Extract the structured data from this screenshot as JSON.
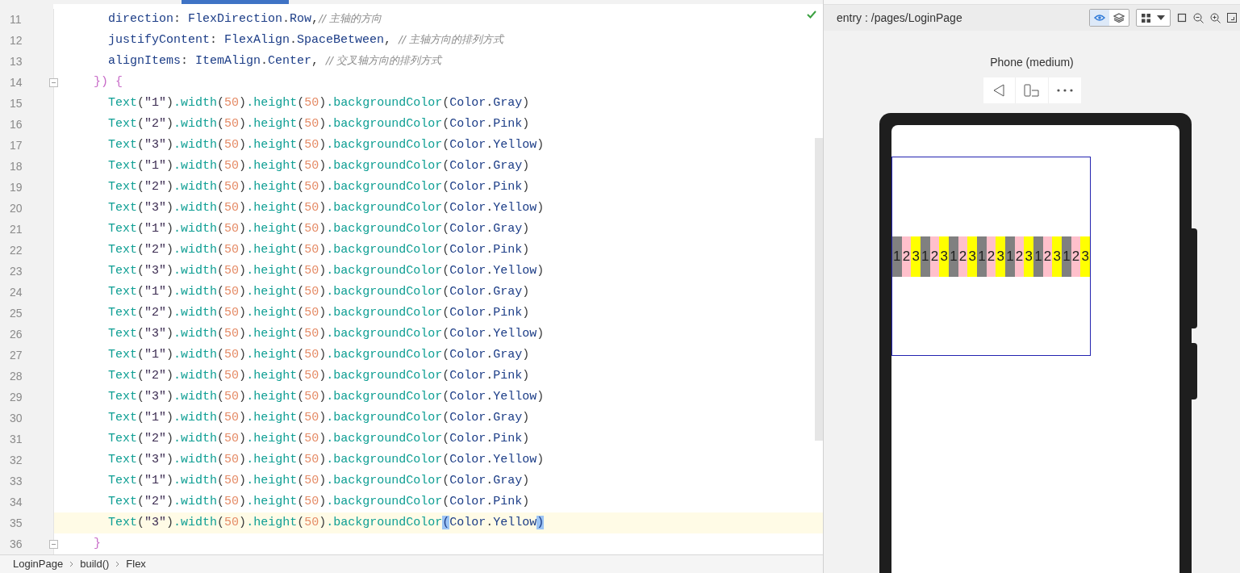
{
  "editor": {
    "lines": [
      {
        "number": "11",
        "current": false,
        "foldable": false,
        "tokens": [
          {
            "text": "      direction",
            "kind": "i"
          },
          {
            "text": ": ",
            "kind": "p"
          },
          {
            "text": "FlexDirection",
            "kind": "i"
          },
          {
            "text": ".",
            "kind": "p"
          },
          {
            "text": "Row",
            "kind": "i"
          },
          {
            "text": ",",
            "kind": "p"
          },
          {
            "text": "// 主轴的方向",
            "kind": "c"
          }
        ]
      },
      {
        "number": "12",
        "current": false,
        "foldable": false,
        "tokens": [
          {
            "text": "      justifyContent",
            "kind": "i"
          },
          {
            "text": ": ",
            "kind": "p"
          },
          {
            "text": "FlexAlign",
            "kind": "i"
          },
          {
            "text": ".",
            "kind": "p"
          },
          {
            "text": "SpaceBetween",
            "kind": "i"
          },
          {
            "text": ", ",
            "kind": "p"
          },
          {
            "text": "// 主轴方向的排列方式",
            "kind": "c"
          }
        ]
      },
      {
        "number": "13",
        "current": false,
        "foldable": false,
        "tokens": [
          {
            "text": "      alignItems",
            "kind": "i"
          },
          {
            "text": ": ",
            "kind": "p"
          },
          {
            "text": "ItemAlign",
            "kind": "i"
          },
          {
            "text": ".",
            "kind": "p"
          },
          {
            "text": "Center",
            "kind": "i"
          },
          {
            "text": ", ",
            "kind": "p"
          },
          {
            "text": "// 交叉轴方向的排列方式",
            "kind": "c"
          }
        ]
      },
      {
        "number": "14",
        "current": false,
        "foldable": true,
        "tokens": [
          {
            "text": "    }) {",
            "kind": "b"
          }
        ]
      },
      {
        "number": "15",
        "current": false,
        "foldable": false,
        "tokens": [
          {
            "text": "      Text",
            "kind": "f"
          },
          {
            "text": "(",
            "kind": "p"
          },
          {
            "text": "\"1\"",
            "kind": "s"
          },
          {
            "text": ")",
            "kind": "p"
          },
          {
            "text": ".width",
            "kind": "f"
          },
          {
            "text": "(",
            "kind": "p"
          },
          {
            "text": "50",
            "kind": "n"
          },
          {
            "text": ")",
            "kind": "p"
          },
          {
            "text": ".height",
            "kind": "f"
          },
          {
            "text": "(",
            "kind": "p"
          },
          {
            "text": "50",
            "kind": "n"
          },
          {
            "text": ")",
            "kind": "p"
          },
          {
            "text": ".backgroundColor",
            "kind": "f"
          },
          {
            "text": "(",
            "kind": "p"
          },
          {
            "text": "Color",
            "kind": "i"
          },
          {
            "text": ".",
            "kind": "p"
          },
          {
            "text": "Gray",
            "kind": "i"
          },
          {
            "text": ")",
            "kind": "p"
          }
        ]
      },
      {
        "number": "16",
        "current": false,
        "foldable": false,
        "tokens": [
          {
            "text": "      Text",
            "kind": "f"
          },
          {
            "text": "(",
            "kind": "p"
          },
          {
            "text": "\"2\"",
            "kind": "s"
          },
          {
            "text": ")",
            "kind": "p"
          },
          {
            "text": ".width",
            "kind": "f"
          },
          {
            "text": "(",
            "kind": "p"
          },
          {
            "text": "50",
            "kind": "n"
          },
          {
            "text": ")",
            "kind": "p"
          },
          {
            "text": ".height",
            "kind": "f"
          },
          {
            "text": "(",
            "kind": "p"
          },
          {
            "text": "50",
            "kind": "n"
          },
          {
            "text": ")",
            "kind": "p"
          },
          {
            "text": ".backgroundColor",
            "kind": "f"
          },
          {
            "text": "(",
            "kind": "p"
          },
          {
            "text": "Color",
            "kind": "i"
          },
          {
            "text": ".",
            "kind": "p"
          },
          {
            "text": "Pink",
            "kind": "i"
          },
          {
            "text": ")",
            "kind": "p"
          }
        ]
      },
      {
        "number": "17",
        "current": false,
        "foldable": false,
        "tokens": [
          {
            "text": "      Text",
            "kind": "f"
          },
          {
            "text": "(",
            "kind": "p"
          },
          {
            "text": "\"3\"",
            "kind": "s"
          },
          {
            "text": ")",
            "kind": "p"
          },
          {
            "text": ".width",
            "kind": "f"
          },
          {
            "text": "(",
            "kind": "p"
          },
          {
            "text": "50",
            "kind": "n"
          },
          {
            "text": ")",
            "kind": "p"
          },
          {
            "text": ".height",
            "kind": "f"
          },
          {
            "text": "(",
            "kind": "p"
          },
          {
            "text": "50",
            "kind": "n"
          },
          {
            "text": ")",
            "kind": "p"
          },
          {
            "text": ".backgroundColor",
            "kind": "f"
          },
          {
            "text": "(",
            "kind": "p"
          },
          {
            "text": "Color",
            "kind": "i"
          },
          {
            "text": ".",
            "kind": "p"
          },
          {
            "text": "Yellow",
            "kind": "i"
          },
          {
            "text": ")",
            "kind": "p"
          }
        ]
      },
      {
        "number": "18",
        "current": false,
        "foldable": false,
        "tokens": [
          {
            "text": "      Text",
            "kind": "f"
          },
          {
            "text": "(",
            "kind": "p"
          },
          {
            "text": "\"1\"",
            "kind": "s"
          },
          {
            "text": ")",
            "kind": "p"
          },
          {
            "text": ".width",
            "kind": "f"
          },
          {
            "text": "(",
            "kind": "p"
          },
          {
            "text": "50",
            "kind": "n"
          },
          {
            "text": ")",
            "kind": "p"
          },
          {
            "text": ".height",
            "kind": "f"
          },
          {
            "text": "(",
            "kind": "p"
          },
          {
            "text": "50",
            "kind": "n"
          },
          {
            "text": ")",
            "kind": "p"
          },
          {
            "text": ".backgroundColor",
            "kind": "f"
          },
          {
            "text": "(",
            "kind": "p"
          },
          {
            "text": "Color",
            "kind": "i"
          },
          {
            "text": ".",
            "kind": "p"
          },
          {
            "text": "Gray",
            "kind": "i"
          },
          {
            "text": ")",
            "kind": "p"
          }
        ]
      },
      {
        "number": "19",
        "current": false,
        "foldable": false,
        "tokens": [
          {
            "text": "      Text",
            "kind": "f"
          },
          {
            "text": "(",
            "kind": "p"
          },
          {
            "text": "\"2\"",
            "kind": "s"
          },
          {
            "text": ")",
            "kind": "p"
          },
          {
            "text": ".width",
            "kind": "f"
          },
          {
            "text": "(",
            "kind": "p"
          },
          {
            "text": "50",
            "kind": "n"
          },
          {
            "text": ")",
            "kind": "p"
          },
          {
            "text": ".height",
            "kind": "f"
          },
          {
            "text": "(",
            "kind": "p"
          },
          {
            "text": "50",
            "kind": "n"
          },
          {
            "text": ")",
            "kind": "p"
          },
          {
            "text": ".backgroundColor",
            "kind": "f"
          },
          {
            "text": "(",
            "kind": "p"
          },
          {
            "text": "Color",
            "kind": "i"
          },
          {
            "text": ".",
            "kind": "p"
          },
          {
            "text": "Pink",
            "kind": "i"
          },
          {
            "text": ")",
            "kind": "p"
          }
        ]
      },
      {
        "number": "20",
        "current": false,
        "foldable": false,
        "tokens": [
          {
            "text": "      Text",
            "kind": "f"
          },
          {
            "text": "(",
            "kind": "p"
          },
          {
            "text": "\"3\"",
            "kind": "s"
          },
          {
            "text": ")",
            "kind": "p"
          },
          {
            "text": ".width",
            "kind": "f"
          },
          {
            "text": "(",
            "kind": "p"
          },
          {
            "text": "50",
            "kind": "n"
          },
          {
            "text": ")",
            "kind": "p"
          },
          {
            "text": ".height",
            "kind": "f"
          },
          {
            "text": "(",
            "kind": "p"
          },
          {
            "text": "50",
            "kind": "n"
          },
          {
            "text": ")",
            "kind": "p"
          },
          {
            "text": ".backgroundColor",
            "kind": "f"
          },
          {
            "text": "(",
            "kind": "p"
          },
          {
            "text": "Color",
            "kind": "i"
          },
          {
            "text": ".",
            "kind": "p"
          },
          {
            "text": "Yellow",
            "kind": "i"
          },
          {
            "text": ")",
            "kind": "p"
          }
        ]
      },
      {
        "number": "21",
        "current": false,
        "foldable": false,
        "tokens": [
          {
            "text": "      Text",
            "kind": "f"
          },
          {
            "text": "(",
            "kind": "p"
          },
          {
            "text": "\"1\"",
            "kind": "s"
          },
          {
            "text": ")",
            "kind": "p"
          },
          {
            "text": ".width",
            "kind": "f"
          },
          {
            "text": "(",
            "kind": "p"
          },
          {
            "text": "50",
            "kind": "n"
          },
          {
            "text": ")",
            "kind": "p"
          },
          {
            "text": ".height",
            "kind": "f"
          },
          {
            "text": "(",
            "kind": "p"
          },
          {
            "text": "50",
            "kind": "n"
          },
          {
            "text": ")",
            "kind": "p"
          },
          {
            "text": ".backgroundColor",
            "kind": "f"
          },
          {
            "text": "(",
            "kind": "p"
          },
          {
            "text": "Color",
            "kind": "i"
          },
          {
            "text": ".",
            "kind": "p"
          },
          {
            "text": "Gray",
            "kind": "i"
          },
          {
            "text": ")",
            "kind": "p"
          }
        ]
      },
      {
        "number": "22",
        "current": false,
        "foldable": false,
        "tokens": [
          {
            "text": "      Text",
            "kind": "f"
          },
          {
            "text": "(",
            "kind": "p"
          },
          {
            "text": "\"2\"",
            "kind": "s"
          },
          {
            "text": ")",
            "kind": "p"
          },
          {
            "text": ".width",
            "kind": "f"
          },
          {
            "text": "(",
            "kind": "p"
          },
          {
            "text": "50",
            "kind": "n"
          },
          {
            "text": ")",
            "kind": "p"
          },
          {
            "text": ".height",
            "kind": "f"
          },
          {
            "text": "(",
            "kind": "p"
          },
          {
            "text": "50",
            "kind": "n"
          },
          {
            "text": ")",
            "kind": "p"
          },
          {
            "text": ".backgroundColor",
            "kind": "f"
          },
          {
            "text": "(",
            "kind": "p"
          },
          {
            "text": "Color",
            "kind": "i"
          },
          {
            "text": ".",
            "kind": "p"
          },
          {
            "text": "Pink",
            "kind": "i"
          },
          {
            "text": ")",
            "kind": "p"
          }
        ]
      },
      {
        "number": "23",
        "current": false,
        "foldable": false,
        "tokens": [
          {
            "text": "      Text",
            "kind": "f"
          },
          {
            "text": "(",
            "kind": "p"
          },
          {
            "text": "\"3\"",
            "kind": "s"
          },
          {
            "text": ")",
            "kind": "p"
          },
          {
            "text": ".width",
            "kind": "f"
          },
          {
            "text": "(",
            "kind": "p"
          },
          {
            "text": "50",
            "kind": "n"
          },
          {
            "text": ")",
            "kind": "p"
          },
          {
            "text": ".height",
            "kind": "f"
          },
          {
            "text": "(",
            "kind": "p"
          },
          {
            "text": "50",
            "kind": "n"
          },
          {
            "text": ")",
            "kind": "p"
          },
          {
            "text": ".backgroundColor",
            "kind": "f"
          },
          {
            "text": "(",
            "kind": "p"
          },
          {
            "text": "Color",
            "kind": "i"
          },
          {
            "text": ".",
            "kind": "p"
          },
          {
            "text": "Yellow",
            "kind": "i"
          },
          {
            "text": ")",
            "kind": "p"
          }
        ]
      },
      {
        "number": "24",
        "current": false,
        "foldable": false,
        "tokens": [
          {
            "text": "      Text",
            "kind": "f"
          },
          {
            "text": "(",
            "kind": "p"
          },
          {
            "text": "\"1\"",
            "kind": "s"
          },
          {
            "text": ")",
            "kind": "p"
          },
          {
            "text": ".width",
            "kind": "f"
          },
          {
            "text": "(",
            "kind": "p"
          },
          {
            "text": "50",
            "kind": "n"
          },
          {
            "text": ")",
            "kind": "p"
          },
          {
            "text": ".height",
            "kind": "f"
          },
          {
            "text": "(",
            "kind": "p"
          },
          {
            "text": "50",
            "kind": "n"
          },
          {
            "text": ")",
            "kind": "p"
          },
          {
            "text": ".backgroundColor",
            "kind": "f"
          },
          {
            "text": "(",
            "kind": "p"
          },
          {
            "text": "Color",
            "kind": "i"
          },
          {
            "text": ".",
            "kind": "p"
          },
          {
            "text": "Gray",
            "kind": "i"
          },
          {
            "text": ")",
            "kind": "p"
          }
        ]
      },
      {
        "number": "25",
        "current": false,
        "foldable": false,
        "tokens": [
          {
            "text": "      Text",
            "kind": "f"
          },
          {
            "text": "(",
            "kind": "p"
          },
          {
            "text": "\"2\"",
            "kind": "s"
          },
          {
            "text": ")",
            "kind": "p"
          },
          {
            "text": ".width",
            "kind": "f"
          },
          {
            "text": "(",
            "kind": "p"
          },
          {
            "text": "50",
            "kind": "n"
          },
          {
            "text": ")",
            "kind": "p"
          },
          {
            "text": ".height",
            "kind": "f"
          },
          {
            "text": "(",
            "kind": "p"
          },
          {
            "text": "50",
            "kind": "n"
          },
          {
            "text": ")",
            "kind": "p"
          },
          {
            "text": ".backgroundColor",
            "kind": "f"
          },
          {
            "text": "(",
            "kind": "p"
          },
          {
            "text": "Color",
            "kind": "i"
          },
          {
            "text": ".",
            "kind": "p"
          },
          {
            "text": "Pink",
            "kind": "i"
          },
          {
            "text": ")",
            "kind": "p"
          }
        ]
      },
      {
        "number": "26",
        "current": false,
        "foldable": false,
        "tokens": [
          {
            "text": "      Text",
            "kind": "f"
          },
          {
            "text": "(",
            "kind": "p"
          },
          {
            "text": "\"3\"",
            "kind": "s"
          },
          {
            "text": ")",
            "kind": "p"
          },
          {
            "text": ".width",
            "kind": "f"
          },
          {
            "text": "(",
            "kind": "p"
          },
          {
            "text": "50",
            "kind": "n"
          },
          {
            "text": ")",
            "kind": "p"
          },
          {
            "text": ".height",
            "kind": "f"
          },
          {
            "text": "(",
            "kind": "p"
          },
          {
            "text": "50",
            "kind": "n"
          },
          {
            "text": ")",
            "kind": "p"
          },
          {
            "text": ".backgroundColor",
            "kind": "f"
          },
          {
            "text": "(",
            "kind": "p"
          },
          {
            "text": "Color",
            "kind": "i"
          },
          {
            "text": ".",
            "kind": "p"
          },
          {
            "text": "Yellow",
            "kind": "i"
          },
          {
            "text": ")",
            "kind": "p"
          }
        ]
      },
      {
        "number": "27",
        "current": false,
        "foldable": false,
        "tokens": [
          {
            "text": "      Text",
            "kind": "f"
          },
          {
            "text": "(",
            "kind": "p"
          },
          {
            "text": "\"1\"",
            "kind": "s"
          },
          {
            "text": ")",
            "kind": "p"
          },
          {
            "text": ".width",
            "kind": "f"
          },
          {
            "text": "(",
            "kind": "p"
          },
          {
            "text": "50",
            "kind": "n"
          },
          {
            "text": ")",
            "kind": "p"
          },
          {
            "text": ".height",
            "kind": "f"
          },
          {
            "text": "(",
            "kind": "p"
          },
          {
            "text": "50",
            "kind": "n"
          },
          {
            "text": ")",
            "kind": "p"
          },
          {
            "text": ".backgroundColor",
            "kind": "f"
          },
          {
            "text": "(",
            "kind": "p"
          },
          {
            "text": "Color",
            "kind": "i"
          },
          {
            "text": ".",
            "kind": "p"
          },
          {
            "text": "Gray",
            "kind": "i"
          },
          {
            "text": ")",
            "kind": "p"
          }
        ]
      },
      {
        "number": "28",
        "current": false,
        "foldable": false,
        "tokens": [
          {
            "text": "      Text",
            "kind": "f"
          },
          {
            "text": "(",
            "kind": "p"
          },
          {
            "text": "\"2\"",
            "kind": "s"
          },
          {
            "text": ")",
            "kind": "p"
          },
          {
            "text": ".width",
            "kind": "f"
          },
          {
            "text": "(",
            "kind": "p"
          },
          {
            "text": "50",
            "kind": "n"
          },
          {
            "text": ")",
            "kind": "p"
          },
          {
            "text": ".height",
            "kind": "f"
          },
          {
            "text": "(",
            "kind": "p"
          },
          {
            "text": "50",
            "kind": "n"
          },
          {
            "text": ")",
            "kind": "p"
          },
          {
            "text": ".backgroundColor",
            "kind": "f"
          },
          {
            "text": "(",
            "kind": "p"
          },
          {
            "text": "Color",
            "kind": "i"
          },
          {
            "text": ".",
            "kind": "p"
          },
          {
            "text": "Pink",
            "kind": "i"
          },
          {
            "text": ")",
            "kind": "p"
          }
        ]
      },
      {
        "number": "29",
        "current": false,
        "foldable": false,
        "tokens": [
          {
            "text": "      Text",
            "kind": "f"
          },
          {
            "text": "(",
            "kind": "p"
          },
          {
            "text": "\"3\"",
            "kind": "s"
          },
          {
            "text": ")",
            "kind": "p"
          },
          {
            "text": ".width",
            "kind": "f"
          },
          {
            "text": "(",
            "kind": "p"
          },
          {
            "text": "50",
            "kind": "n"
          },
          {
            "text": ")",
            "kind": "p"
          },
          {
            "text": ".height",
            "kind": "f"
          },
          {
            "text": "(",
            "kind": "p"
          },
          {
            "text": "50",
            "kind": "n"
          },
          {
            "text": ")",
            "kind": "p"
          },
          {
            "text": ".backgroundColor",
            "kind": "f"
          },
          {
            "text": "(",
            "kind": "p"
          },
          {
            "text": "Color",
            "kind": "i"
          },
          {
            "text": ".",
            "kind": "p"
          },
          {
            "text": "Yellow",
            "kind": "i"
          },
          {
            "text": ")",
            "kind": "p"
          }
        ]
      },
      {
        "number": "30",
        "current": false,
        "foldable": false,
        "tokens": [
          {
            "text": "      Text",
            "kind": "f"
          },
          {
            "text": "(",
            "kind": "p"
          },
          {
            "text": "\"1\"",
            "kind": "s"
          },
          {
            "text": ")",
            "kind": "p"
          },
          {
            "text": ".width",
            "kind": "f"
          },
          {
            "text": "(",
            "kind": "p"
          },
          {
            "text": "50",
            "kind": "n"
          },
          {
            "text": ")",
            "kind": "p"
          },
          {
            "text": ".height",
            "kind": "f"
          },
          {
            "text": "(",
            "kind": "p"
          },
          {
            "text": "50",
            "kind": "n"
          },
          {
            "text": ")",
            "kind": "p"
          },
          {
            "text": ".backgroundColor",
            "kind": "f"
          },
          {
            "text": "(",
            "kind": "p"
          },
          {
            "text": "Color",
            "kind": "i"
          },
          {
            "text": ".",
            "kind": "p"
          },
          {
            "text": "Gray",
            "kind": "i"
          },
          {
            "text": ")",
            "kind": "p"
          }
        ]
      },
      {
        "number": "31",
        "current": false,
        "foldable": false,
        "tokens": [
          {
            "text": "      Text",
            "kind": "f"
          },
          {
            "text": "(",
            "kind": "p"
          },
          {
            "text": "\"2\"",
            "kind": "s"
          },
          {
            "text": ")",
            "kind": "p"
          },
          {
            "text": ".width",
            "kind": "f"
          },
          {
            "text": "(",
            "kind": "p"
          },
          {
            "text": "50",
            "kind": "n"
          },
          {
            "text": ")",
            "kind": "p"
          },
          {
            "text": ".height",
            "kind": "f"
          },
          {
            "text": "(",
            "kind": "p"
          },
          {
            "text": "50",
            "kind": "n"
          },
          {
            "text": ")",
            "kind": "p"
          },
          {
            "text": ".backgroundColor",
            "kind": "f"
          },
          {
            "text": "(",
            "kind": "p"
          },
          {
            "text": "Color",
            "kind": "i"
          },
          {
            "text": ".",
            "kind": "p"
          },
          {
            "text": "Pink",
            "kind": "i"
          },
          {
            "text": ")",
            "kind": "p"
          }
        ]
      },
      {
        "number": "32",
        "current": false,
        "foldable": false,
        "tokens": [
          {
            "text": "      Text",
            "kind": "f"
          },
          {
            "text": "(",
            "kind": "p"
          },
          {
            "text": "\"3\"",
            "kind": "s"
          },
          {
            "text": ")",
            "kind": "p"
          },
          {
            "text": ".width",
            "kind": "f"
          },
          {
            "text": "(",
            "kind": "p"
          },
          {
            "text": "50",
            "kind": "n"
          },
          {
            "text": ")",
            "kind": "p"
          },
          {
            "text": ".height",
            "kind": "f"
          },
          {
            "text": "(",
            "kind": "p"
          },
          {
            "text": "50",
            "kind": "n"
          },
          {
            "text": ")",
            "kind": "p"
          },
          {
            "text": ".backgroundColor",
            "kind": "f"
          },
          {
            "text": "(",
            "kind": "p"
          },
          {
            "text": "Color",
            "kind": "i"
          },
          {
            "text": ".",
            "kind": "p"
          },
          {
            "text": "Yellow",
            "kind": "i"
          },
          {
            "text": ")",
            "kind": "p"
          }
        ]
      },
      {
        "number": "33",
        "current": false,
        "foldable": false,
        "tokens": [
          {
            "text": "      Text",
            "kind": "f"
          },
          {
            "text": "(",
            "kind": "p"
          },
          {
            "text": "\"1\"",
            "kind": "s"
          },
          {
            "text": ")",
            "kind": "p"
          },
          {
            "text": ".width",
            "kind": "f"
          },
          {
            "text": "(",
            "kind": "p"
          },
          {
            "text": "50",
            "kind": "n"
          },
          {
            "text": ")",
            "kind": "p"
          },
          {
            "text": ".height",
            "kind": "f"
          },
          {
            "text": "(",
            "kind": "p"
          },
          {
            "text": "50",
            "kind": "n"
          },
          {
            "text": ")",
            "kind": "p"
          },
          {
            "text": ".backgroundColor",
            "kind": "f"
          },
          {
            "text": "(",
            "kind": "p"
          },
          {
            "text": "Color",
            "kind": "i"
          },
          {
            "text": ".",
            "kind": "p"
          },
          {
            "text": "Gray",
            "kind": "i"
          },
          {
            "text": ")",
            "kind": "p"
          }
        ]
      },
      {
        "number": "34",
        "current": false,
        "foldable": false,
        "tokens": [
          {
            "text": "      Text",
            "kind": "f"
          },
          {
            "text": "(",
            "kind": "p"
          },
          {
            "text": "\"2\"",
            "kind": "s"
          },
          {
            "text": ")",
            "kind": "p"
          },
          {
            "text": ".width",
            "kind": "f"
          },
          {
            "text": "(",
            "kind": "p"
          },
          {
            "text": "50",
            "kind": "n"
          },
          {
            "text": ")",
            "kind": "p"
          },
          {
            "text": ".height",
            "kind": "f"
          },
          {
            "text": "(",
            "kind": "p"
          },
          {
            "text": "50",
            "kind": "n"
          },
          {
            "text": ")",
            "kind": "p"
          },
          {
            "text": ".backgroundColor",
            "kind": "f"
          },
          {
            "text": "(",
            "kind": "p"
          },
          {
            "text": "Color",
            "kind": "i"
          },
          {
            "text": ".",
            "kind": "p"
          },
          {
            "text": "Pink",
            "kind": "i"
          },
          {
            "text": ")",
            "kind": "p"
          }
        ]
      },
      {
        "number": "35",
        "current": true,
        "foldable": false,
        "tokens": [
          {
            "text": "      Text",
            "kind": "f"
          },
          {
            "text": "(",
            "kind": "p"
          },
          {
            "text": "\"3\"",
            "kind": "s"
          },
          {
            "text": ")",
            "kind": "p"
          },
          {
            "text": ".width",
            "kind": "f"
          },
          {
            "text": "(",
            "kind": "p"
          },
          {
            "text": "50",
            "kind": "n"
          },
          {
            "text": ")",
            "kind": "p"
          },
          {
            "text": ".height",
            "kind": "f"
          },
          {
            "text": "(",
            "kind": "p"
          },
          {
            "text": "50",
            "kind": "n"
          },
          {
            "text": ")",
            "kind": "p"
          },
          {
            "text": ".backgroundColor",
            "kind": "f"
          },
          {
            "text": "(",
            "kind": "m"
          },
          {
            "text": "Color",
            "kind": "i"
          },
          {
            "text": ".",
            "kind": "p"
          },
          {
            "text": "Yellow",
            "kind": "i"
          },
          {
            "text": ")",
            "kind": "m"
          }
        ]
      },
      {
        "number": "36",
        "current": false,
        "foldable": true,
        "tokens": [
          {
            "text": "    }",
            "kind": "b"
          }
        ]
      }
    ]
  },
  "breadcrumb": [
    "LoginPage",
    "build()",
    "Flex"
  ],
  "preview": {
    "path": "entry : /pages/LoginPage",
    "inspect_on": true,
    "device": "Phone (medium)",
    "items": [
      {
        "label": "1",
        "color": "#808080"
      },
      {
        "label": "2",
        "color": "#ffc0cb"
      },
      {
        "label": "3",
        "color": "#ffff00"
      },
      {
        "label": "1",
        "color": "#808080"
      },
      {
        "label": "2",
        "color": "#ffc0cb"
      },
      {
        "label": "3",
        "color": "#ffff00"
      },
      {
        "label": "1",
        "color": "#808080"
      },
      {
        "label": "2",
        "color": "#ffc0cb"
      },
      {
        "label": "3",
        "color": "#ffff00"
      },
      {
        "label": "1",
        "color": "#808080"
      },
      {
        "label": "2",
        "color": "#ffc0cb"
      },
      {
        "label": "3",
        "color": "#ffff00"
      },
      {
        "label": "1",
        "color": "#808080"
      },
      {
        "label": "2",
        "color": "#ffc0cb"
      },
      {
        "label": "3",
        "color": "#ffff00"
      },
      {
        "label": "1",
        "color": "#808080"
      },
      {
        "label": "2",
        "color": "#ffc0cb"
      },
      {
        "label": "3",
        "color": "#ffff00"
      },
      {
        "label": "1",
        "color": "#808080"
      },
      {
        "label": "2",
        "color": "#ffc0cb"
      },
      {
        "label": "3",
        "color": "#ffff00"
      }
    ]
  }
}
